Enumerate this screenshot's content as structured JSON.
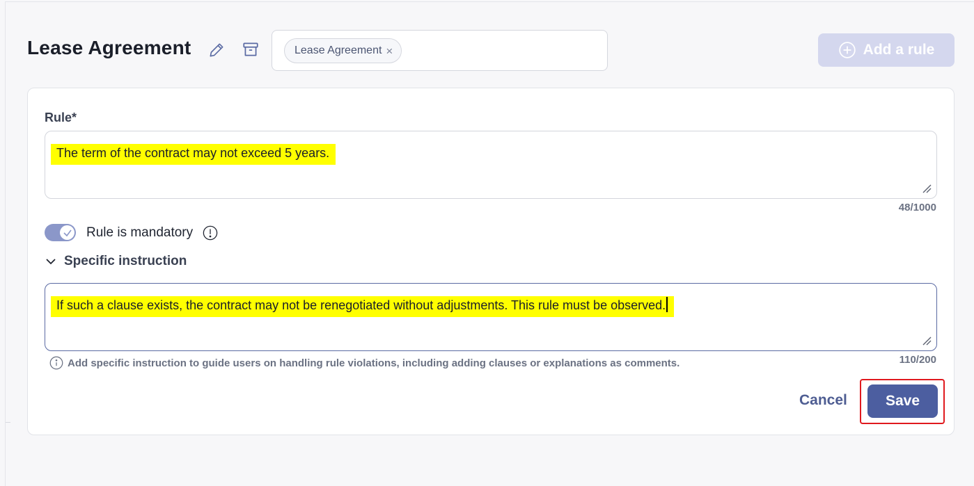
{
  "header": {
    "title": "Lease Agreement",
    "tags": [
      {
        "label": "Lease Agreement"
      }
    ],
    "tag_remove_glyph": "×",
    "add_rule_label": "Add a rule"
  },
  "form": {
    "rule_label": "Rule*",
    "rule_value": "The term of the contract may not exceed 5 years.",
    "rule_counter": "48/1000",
    "mandatory_label": "Rule is mandatory",
    "mandatory_on": true,
    "instruction_section_label": "Specific instruction",
    "instruction_value": "If such a clause exists, the contract may not be renegotiated without adjustments. This rule must be observed.",
    "instruction_counter": "110/200",
    "instruction_hint": "Add specific instruction to guide users on handling rule violations, including adding clauses or explanations as comments.",
    "cancel_label": "Cancel",
    "save_label": "Save"
  },
  "icons": {
    "edit": "pencil-icon",
    "archive": "archive-icon",
    "add": "plus-circle-icon",
    "info": "exclamation-circle-icon",
    "hint": "info-circle-icon",
    "chevron": "chevron-down-icon",
    "check": "check-icon",
    "resize": "resize-handle-icon"
  },
  "colors": {
    "primary": "#4c5ea0",
    "primary_disabled": "#d4d7ee",
    "highlight": "#ffff00",
    "annotation_red": "#e0191e",
    "toggle_on": "#8b97c9"
  }
}
